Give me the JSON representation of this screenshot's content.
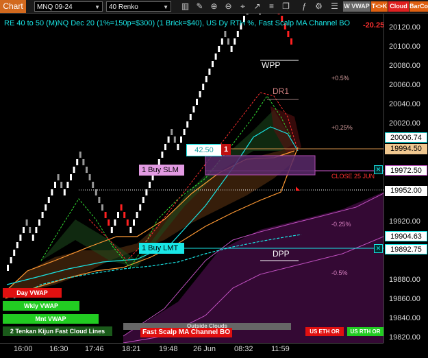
{
  "toolbar": {
    "chart_tab": "Chart",
    "instrument": "MNQ 09-24",
    "bar_type": "40 Renko",
    "wvwap": "W VWAP",
    "tk": "T<>K",
    "cloud": "Cloud",
    "barco": "BarCo"
  },
  "title": "RE 40 to 50 (M)NQ Dec 20 (1%=150p=$300) (1 Brick=$40), US Dy RTH %, Fast Scalp MA Channel BO",
  "top_right_value": "-20.25",
  "price_ticks": [
    "20120.00",
    "20100.00",
    "20080.00",
    "20060.00",
    "20040.00",
    "20020.00",
    "19920.00",
    "19880.00",
    "19860.00",
    "19840.00",
    "19820.00"
  ],
  "price_tags": {
    "p1": "20006.74",
    "p2": "19994.50",
    "p3": "19972.50",
    "p4": "19952.00",
    "p5": "19904.63",
    "p6": "19892.75"
  },
  "time_ticks": [
    "16:00",
    "16:30",
    "17:46",
    "18:21",
    "19:48",
    "26 Jun",
    "08:32",
    "11:59"
  ],
  "labels": {
    "wpp": "WPP",
    "dr1": "DR1",
    "dpp": "DPP",
    "pct_p05": "+0.5%",
    "pct_p025": "+0.25%",
    "pct_m025": "-0.25%",
    "pct_m05": "-0.5%",
    "close": "CLOSE 25 JUN",
    "value_4250": "42.50",
    "count_1": "1",
    "buy_slm": "1 Buy SLM",
    "buy_lmt": "1 Buy LMT"
  },
  "legend": {
    "day_vwap": "Day VWAP",
    "wkly_vwap": "Wkly VWAP",
    "mnt_vwap": "Mnt VWAP",
    "kijun": "2 Tenkan Kijun Fast Cloud Lines",
    "outside": "Outside Clouds",
    "fast_scalp": "Fast Scalp MA Channel BO",
    "us_eth": "US ETH OR",
    "us_rth": "US RTH OR"
  },
  "colors": {
    "cyan": "#19e6e6",
    "orange": "#ff9933",
    "magenta": "#d25ad2",
    "red": "#ff2020",
    "green": "#22cc22"
  }
}
